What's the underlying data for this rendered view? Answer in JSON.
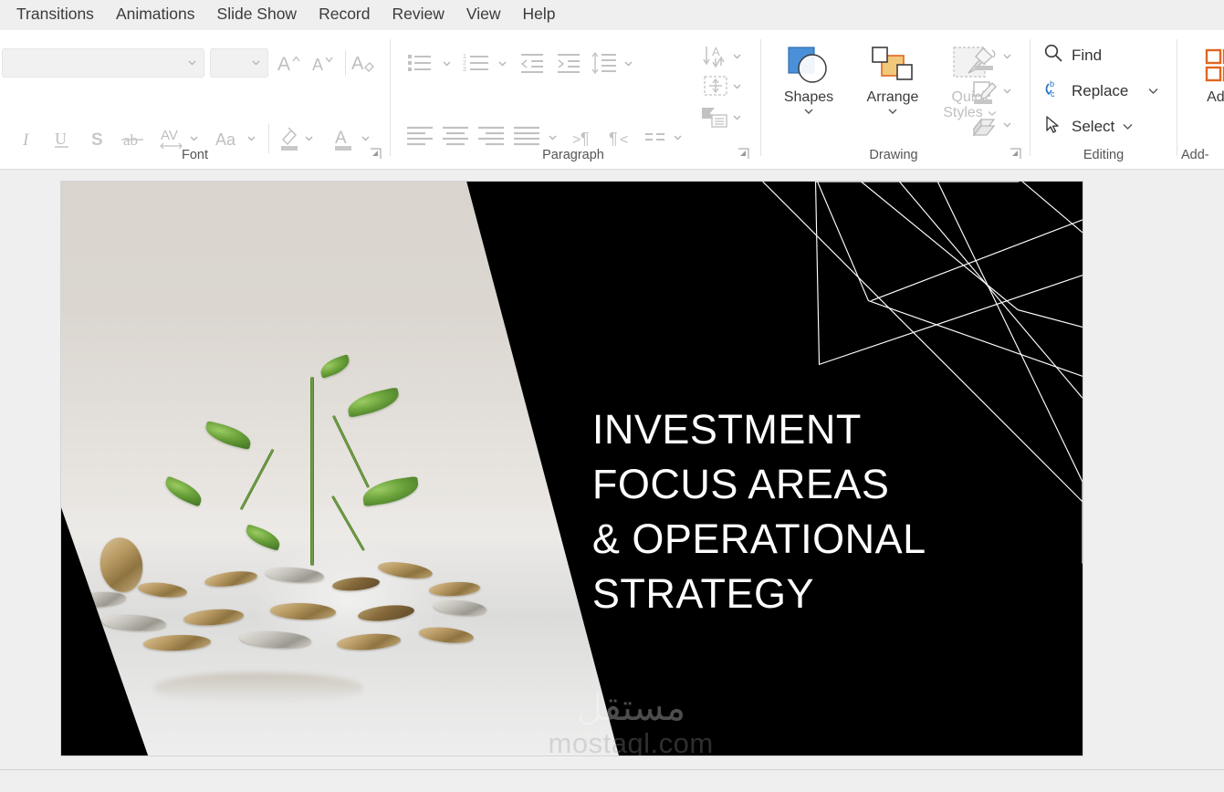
{
  "tabs": [
    {
      "label": "Transitions"
    },
    {
      "label": "Animations"
    },
    {
      "label": "Slide Show"
    },
    {
      "label": "Record"
    },
    {
      "label": "Review"
    },
    {
      "label": "View"
    },
    {
      "label": "Help"
    }
  ],
  "ribbon": {
    "groups": {
      "font": {
        "label": "Font",
        "font_name_value": "",
        "font_name_placeholder": "",
        "font_size_value": "",
        "font_size_placeholder": "",
        "buttons": [
          {
            "name": "increase-font-size",
            "label": "A"
          },
          {
            "name": "decrease-font-size",
            "label": "A"
          },
          {
            "name": "clear-formatting",
            "label": "A"
          },
          {
            "name": "italic",
            "label": "I"
          },
          {
            "name": "underline",
            "label": "U"
          },
          {
            "name": "text-shadow",
            "label": "S"
          },
          {
            "name": "strikethrough",
            "label": "ab"
          },
          {
            "name": "character-spacing",
            "label": "AV"
          },
          {
            "name": "change-case",
            "label": "Aa"
          },
          {
            "name": "text-highlight-color",
            "label": ""
          },
          {
            "name": "font-color",
            "label": "A"
          }
        ]
      },
      "paragraph": {
        "label": "Paragraph",
        "buttons": [
          {
            "name": "bullets",
            "label": ""
          },
          {
            "name": "numbering",
            "label": ""
          },
          {
            "name": "decrease-indent",
            "label": ""
          },
          {
            "name": "increase-indent",
            "label": ""
          },
          {
            "name": "line-spacing",
            "label": ""
          },
          {
            "name": "align-left",
            "label": ""
          },
          {
            "name": "align-center",
            "label": ""
          },
          {
            "name": "align-right",
            "label": ""
          },
          {
            "name": "justify",
            "label": ""
          },
          {
            "name": "ltr-text-direction",
            "label": ""
          },
          {
            "name": "rtl-text-direction",
            "label": ""
          },
          {
            "name": "columns",
            "label": ""
          },
          {
            "name": "text-direction",
            "label": ""
          },
          {
            "name": "align-text",
            "label": ""
          },
          {
            "name": "convert-to-smartart",
            "label": ""
          }
        ]
      },
      "drawing": {
        "label": "Drawing",
        "shapes_label": "Shapes",
        "arrange_label": "Arrange",
        "quick_styles_label_line1": "Quick",
        "quick_styles_label_line2": "Styles",
        "shape_fill_name": "shape-fill",
        "shape_outline_name": "shape-outline",
        "shape_effects_name": "shape-effects"
      },
      "editing": {
        "label": "Editing",
        "find_label": "Find",
        "replace_label": "Replace",
        "select_label": "Select"
      },
      "addins": {
        "label": "Add-",
        "button_label": "Add-"
      }
    }
  },
  "slide": {
    "title": "INVESTMENT\nFOCUS AREAS\n& OPERATIONAL\nSTRATEGY",
    "background_color": "#000000",
    "title_color": "#FFFFFF",
    "watermark_arabic": "مستقل",
    "watermark_latin": "mostaql.com"
  }
}
